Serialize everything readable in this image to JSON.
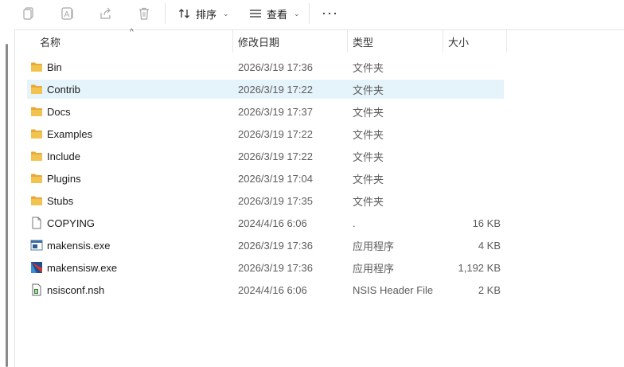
{
  "toolbar": {
    "icons": [
      "copy-icon",
      "rename-icon",
      "share-icon",
      "delete-icon"
    ],
    "sort_label": "排序",
    "view_label": "查看",
    "more_label": "···"
  },
  "columns": {
    "name": "名称",
    "date": "修改日期",
    "type": "类型",
    "size": "大小"
  },
  "files": [
    {
      "name": "Bin",
      "date": "2026/3/19 17:36",
      "type": "文件夹",
      "size": "",
      "icon": "folder-icon"
    },
    {
      "name": "Contrib",
      "date": "2026/3/19 17:22",
      "type": "文件夹",
      "size": "",
      "icon": "folder-icon",
      "selected": true
    },
    {
      "name": "Docs",
      "date": "2026/3/19 17:37",
      "type": "文件夹",
      "size": "",
      "icon": "folder-icon"
    },
    {
      "name": "Examples",
      "date": "2026/3/19 17:22",
      "type": "文件夹",
      "size": "",
      "icon": "folder-icon"
    },
    {
      "name": "Include",
      "date": "2026/3/19 17:22",
      "type": "文件夹",
      "size": "",
      "icon": "folder-icon"
    },
    {
      "name": "Plugins",
      "date": "2026/3/19 17:04",
      "type": "文件夹",
      "size": "",
      "icon": "folder-icon"
    },
    {
      "name": "Stubs",
      "date": "2026/3/19 17:35",
      "type": "文件夹",
      "size": "",
      "icon": "folder-icon"
    },
    {
      "name": "COPYING",
      "date": "2024/4/16 6:06",
      "type": ".",
      "size": "16 KB",
      "icon": "file-icon"
    },
    {
      "name": "makensis.exe",
      "date": "2026/3/19 17:36",
      "type": "应用程序",
      "size": "4 KB",
      "icon": "console-app-icon"
    },
    {
      "name": "makensisw.exe",
      "date": "2026/3/19 17:36",
      "type": "应用程序",
      "size": "1,192 KB",
      "icon": "nsis-app-icon"
    },
    {
      "name": "nsisconf.nsh",
      "date": "2024/4/16 6:06",
      "type": "NSIS Header File",
      "size": "2 KB",
      "icon": "nsh-file-icon"
    }
  ],
  "colors": {
    "selection": "#e5f3fb",
    "folder": "#f3c34f",
    "toolbar_icon_disabled": "#a8a8a8"
  }
}
